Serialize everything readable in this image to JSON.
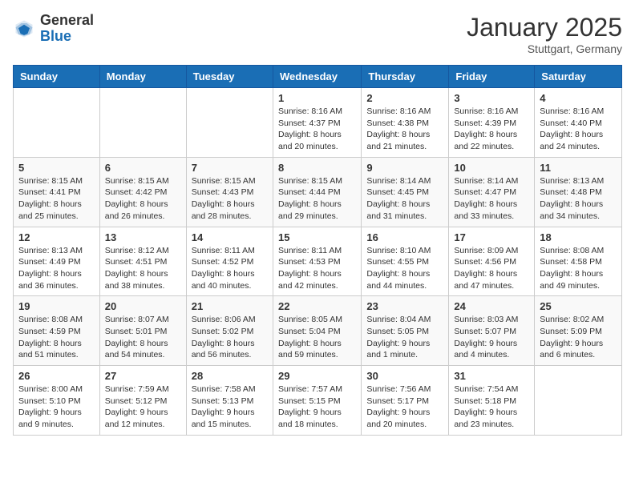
{
  "header": {
    "logo_general": "General",
    "logo_blue": "Blue",
    "month_title": "January 2025",
    "location": "Stuttgart, Germany"
  },
  "days_of_week": [
    "Sunday",
    "Monday",
    "Tuesday",
    "Wednesday",
    "Thursday",
    "Friday",
    "Saturday"
  ],
  "weeks": [
    [
      {
        "day": "",
        "content": ""
      },
      {
        "day": "",
        "content": ""
      },
      {
        "day": "",
        "content": ""
      },
      {
        "day": "1",
        "content": "Sunrise: 8:16 AM\nSunset: 4:37 PM\nDaylight: 8 hours and 20 minutes."
      },
      {
        "day": "2",
        "content": "Sunrise: 8:16 AM\nSunset: 4:38 PM\nDaylight: 8 hours and 21 minutes."
      },
      {
        "day": "3",
        "content": "Sunrise: 8:16 AM\nSunset: 4:39 PM\nDaylight: 8 hours and 22 minutes."
      },
      {
        "day": "4",
        "content": "Sunrise: 8:16 AM\nSunset: 4:40 PM\nDaylight: 8 hours and 24 minutes."
      }
    ],
    [
      {
        "day": "5",
        "content": "Sunrise: 8:15 AM\nSunset: 4:41 PM\nDaylight: 8 hours and 25 minutes."
      },
      {
        "day": "6",
        "content": "Sunrise: 8:15 AM\nSunset: 4:42 PM\nDaylight: 8 hours and 26 minutes."
      },
      {
        "day": "7",
        "content": "Sunrise: 8:15 AM\nSunset: 4:43 PM\nDaylight: 8 hours and 28 minutes."
      },
      {
        "day": "8",
        "content": "Sunrise: 8:15 AM\nSunset: 4:44 PM\nDaylight: 8 hours and 29 minutes."
      },
      {
        "day": "9",
        "content": "Sunrise: 8:14 AM\nSunset: 4:45 PM\nDaylight: 8 hours and 31 minutes."
      },
      {
        "day": "10",
        "content": "Sunrise: 8:14 AM\nSunset: 4:47 PM\nDaylight: 8 hours and 33 minutes."
      },
      {
        "day": "11",
        "content": "Sunrise: 8:13 AM\nSunset: 4:48 PM\nDaylight: 8 hours and 34 minutes."
      }
    ],
    [
      {
        "day": "12",
        "content": "Sunrise: 8:13 AM\nSunset: 4:49 PM\nDaylight: 8 hours and 36 minutes."
      },
      {
        "day": "13",
        "content": "Sunrise: 8:12 AM\nSunset: 4:51 PM\nDaylight: 8 hours and 38 minutes."
      },
      {
        "day": "14",
        "content": "Sunrise: 8:11 AM\nSunset: 4:52 PM\nDaylight: 8 hours and 40 minutes."
      },
      {
        "day": "15",
        "content": "Sunrise: 8:11 AM\nSunset: 4:53 PM\nDaylight: 8 hours and 42 minutes."
      },
      {
        "day": "16",
        "content": "Sunrise: 8:10 AM\nSunset: 4:55 PM\nDaylight: 8 hours and 44 minutes."
      },
      {
        "day": "17",
        "content": "Sunrise: 8:09 AM\nSunset: 4:56 PM\nDaylight: 8 hours and 47 minutes."
      },
      {
        "day": "18",
        "content": "Sunrise: 8:08 AM\nSunset: 4:58 PM\nDaylight: 8 hours and 49 minutes."
      }
    ],
    [
      {
        "day": "19",
        "content": "Sunrise: 8:08 AM\nSunset: 4:59 PM\nDaylight: 8 hours and 51 minutes."
      },
      {
        "day": "20",
        "content": "Sunrise: 8:07 AM\nSunset: 5:01 PM\nDaylight: 8 hours and 54 minutes."
      },
      {
        "day": "21",
        "content": "Sunrise: 8:06 AM\nSunset: 5:02 PM\nDaylight: 8 hours and 56 minutes."
      },
      {
        "day": "22",
        "content": "Sunrise: 8:05 AM\nSunset: 5:04 PM\nDaylight: 8 hours and 59 minutes."
      },
      {
        "day": "23",
        "content": "Sunrise: 8:04 AM\nSunset: 5:05 PM\nDaylight: 9 hours and 1 minute."
      },
      {
        "day": "24",
        "content": "Sunrise: 8:03 AM\nSunset: 5:07 PM\nDaylight: 9 hours and 4 minutes."
      },
      {
        "day": "25",
        "content": "Sunrise: 8:02 AM\nSunset: 5:09 PM\nDaylight: 9 hours and 6 minutes."
      }
    ],
    [
      {
        "day": "26",
        "content": "Sunrise: 8:00 AM\nSunset: 5:10 PM\nDaylight: 9 hours and 9 minutes."
      },
      {
        "day": "27",
        "content": "Sunrise: 7:59 AM\nSunset: 5:12 PM\nDaylight: 9 hours and 12 minutes."
      },
      {
        "day": "28",
        "content": "Sunrise: 7:58 AM\nSunset: 5:13 PM\nDaylight: 9 hours and 15 minutes."
      },
      {
        "day": "29",
        "content": "Sunrise: 7:57 AM\nSunset: 5:15 PM\nDaylight: 9 hours and 18 minutes."
      },
      {
        "day": "30",
        "content": "Sunrise: 7:56 AM\nSunset: 5:17 PM\nDaylight: 9 hours and 20 minutes."
      },
      {
        "day": "31",
        "content": "Sunrise: 7:54 AM\nSunset: 5:18 PM\nDaylight: 9 hours and 23 minutes."
      },
      {
        "day": "",
        "content": ""
      }
    ]
  ]
}
